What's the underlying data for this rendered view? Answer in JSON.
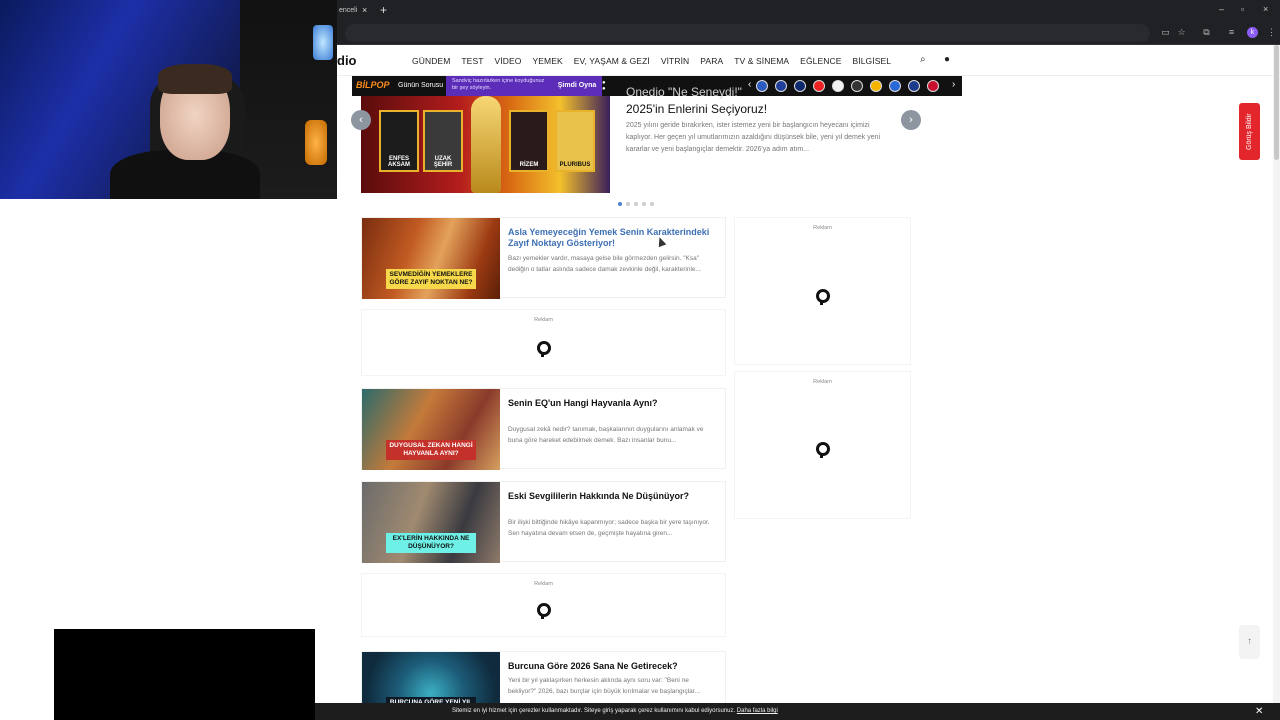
{
  "browser": {
    "tab_title": "enceli",
    "tab_close": "×",
    "new_tab": "+",
    "window_controls": [
      "–",
      "▫",
      "×"
    ]
  },
  "nav": {
    "logo": "dio",
    "items": [
      "GÜNDEM",
      "TEST",
      "VİDEO",
      "YEMEK",
      "EV, YAŞAM & GEZİ",
      "VİTRİN",
      "PARA",
      "TV & SİNEMA",
      "EĞLENCE",
      "BİLGİSEL"
    ],
    "search_icon": "search-icon",
    "user_icon": "user-icon"
  },
  "bilpop": {
    "logo": "BİLPOP",
    "question": "Günün Sorusu",
    "promo": "Sandviç hazırlarken içine koyduğunuz bir şey söyleyin.",
    "play": "Şimdi Oyna"
  },
  "carousel": {
    "title_ghost": "Onedio \"Ne Seneydi!\"",
    "title": "2025'in Enlerini Seçiyoruz!",
    "description": "2025 yılını geride bırakırken, ister istemez yeni bir başlangıcın heyecanı içimizi kaplıyor. Her geçen yıl umutlarımızın azaldığını düşünsek bile, yeni yıl demek yeni kararlar ve yeni başlangıçlar demektir. 2026'ya adım atım...",
    "posters": [
      "ENFES AKSAM",
      "UZAK ŞEHİR",
      "RİZEM",
      "PLURIBUS"
    ],
    "prev": "‹",
    "next": "›"
  },
  "articles": [
    {
      "title": "Asla Yemeyeceğin Yemek Senin Karakterindeki Zayıf Noktayı Gösteriyor!",
      "desc": "Bazı yemekler vardır, masaya gelse bile görmezden gelirsin. \"Ksa\" dediğin o tatlar aslında sadece damak zevkinle değil, karakterinle...",
      "img_label": "SEVMEDİĞİN YEMEKLERE GÖRE ZAYIF NOKTAN NE?"
    },
    {
      "title": "Senin EQ'un Hangi Hayvanla Aynı?",
      "desc": "Duygusal zekâ nedir? tanımak, başkalarının duygularını anlamak ve buna göre hareket edebilmek demek. Bazı insanlar bunu...",
      "img_label": "DUYGUSAL ZEKAN HANGİ HAYVANLA AYNI?"
    },
    {
      "title": "Eski Sevgililerin Hakkında Ne Düşünüyor?",
      "desc": "Bir ilişki bittiğinde hikâye kapanmıyor; sadece başka bir yere taşınıyor. Sen hayatına devam etsen de, geçmişte hayatına giren...",
      "img_label": "EX'LERİN HAKKINDA NE DÜŞÜNÜYOR?"
    },
    {
      "title": "Burcuna Göre 2026 Sana Ne Getirecek?",
      "desc": "Yeni bir yıl yaklaşırken herkesin aklında aynı soru var: \"Beni ne bekliyor?\" 2026, bazı burçlar için büyük kırılmalar ve başlangıçlar...",
      "img_label": "BURCUNA GÖRE YENİ YIL SANA NE GETİRECEK?"
    }
  ],
  "ad_label": "Reklam",
  "side_tab": "Görüş Bildir",
  "scroll_top": "↑",
  "cookie": {
    "text": "Sitemiz en iyi hizmet için çerezler kullanmaktadır. Siteye giriş yaparak çerez kullanımını kabul ediyorsunuz.",
    "link": "Daha fazla bilgi",
    "close": "✕"
  },
  "colors": {
    "accent": "#3d6fb5",
    "side_tab": "#e3262b",
    "bilpop_purple": "#5b2db8",
    "bilpop_orange": "#ff8c1a"
  }
}
